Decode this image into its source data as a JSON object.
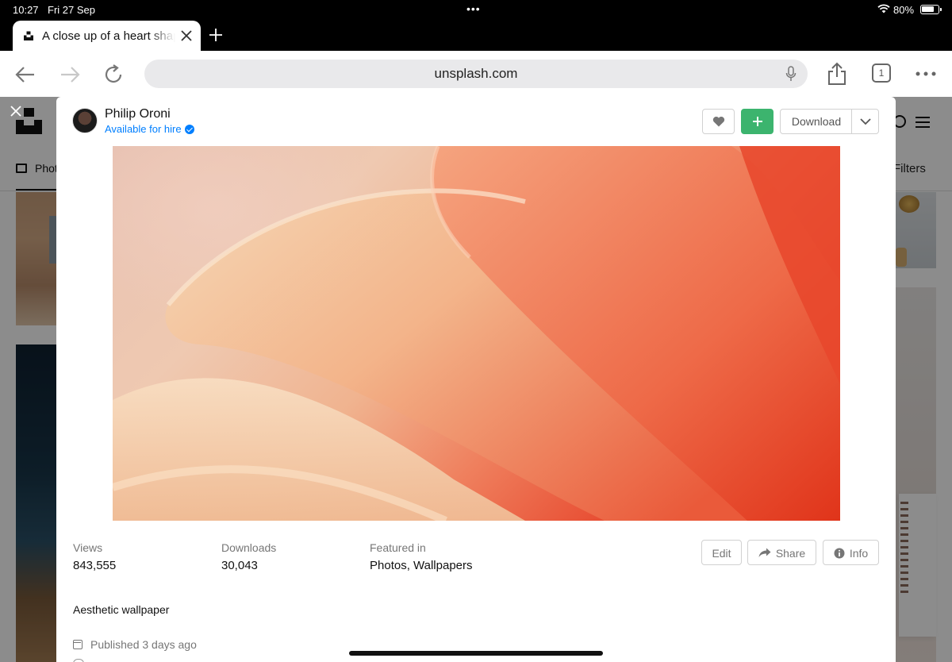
{
  "status_bar": {
    "time": "10:27",
    "date": "Fri 27 Sep",
    "battery_pct": "80%",
    "battery_level": 0.8
  },
  "browser": {
    "tab_title": "A close up of a heart shaped object",
    "url": "unsplash.com",
    "tabs_count": "1"
  },
  "background_page": {
    "nav_photos": "Photos",
    "filters": "Filters"
  },
  "modal": {
    "author": {
      "name": "Philip Oroni",
      "status": "Available for hire"
    },
    "download_label": "Download",
    "stats": [
      {
        "label": "Views",
        "value": "843,555"
      },
      {
        "label": "Downloads",
        "value": "30,043"
      },
      {
        "label": "Featured in",
        "value": "Photos, Wallpapers"
      }
    ],
    "actions": {
      "edit": "Edit",
      "share": "Share",
      "info": "Info"
    },
    "description": "Aesthetic wallpaper",
    "published": "Published 3 days ago"
  },
  "colors": {
    "accent_blue": "#007fff",
    "collect_green": "#3cb46e"
  },
  "icons": [
    "back-arrow-icon",
    "forward-arrow-icon",
    "reload-icon",
    "microphone-icon",
    "share-icon",
    "more-icon",
    "heart-icon",
    "plus-icon",
    "chevron-down-icon",
    "info-icon",
    "calendar-icon",
    "close-icon"
  ]
}
